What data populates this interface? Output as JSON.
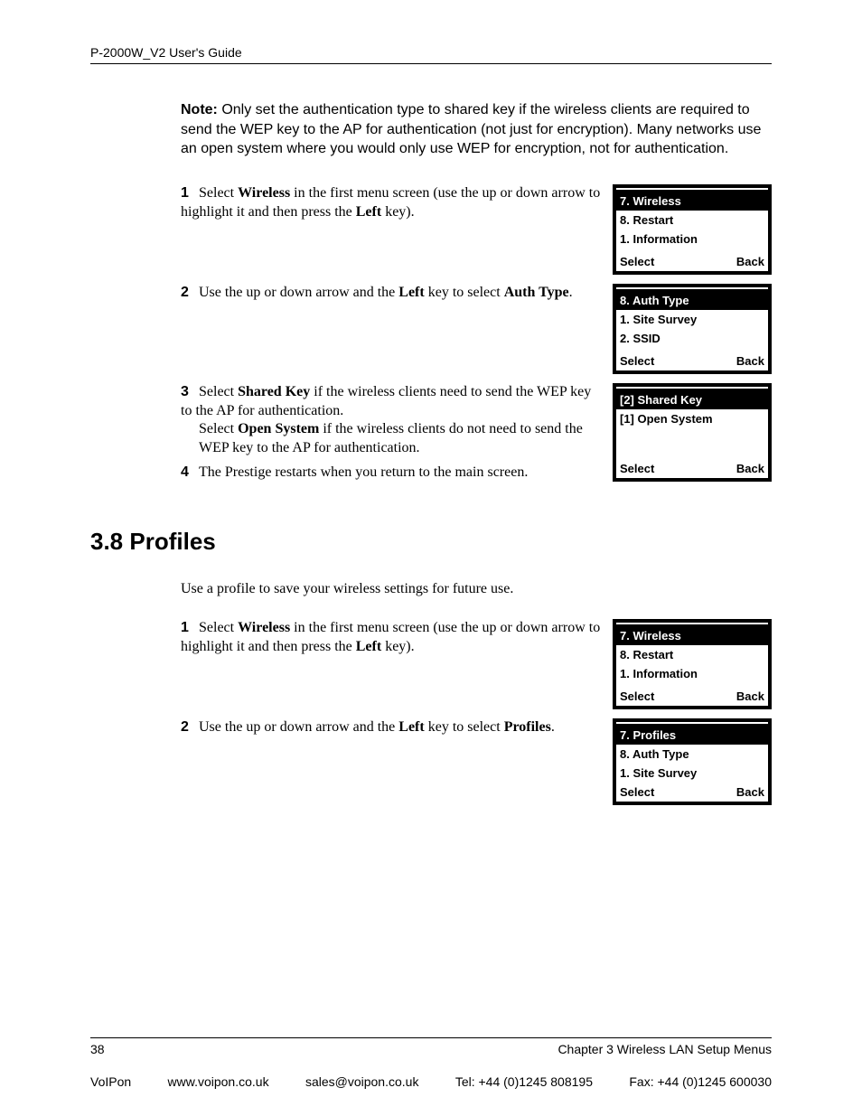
{
  "header_title": "P-2000W_V2 User's Guide",
  "note": {
    "label": "Note:",
    "text": " Only set the authentication type to shared key if the wireless clients are required to send the WEP key to the AP for authentication (not just for encryption). Many networks use an open system where you would only use WEP for encryption, not for authentication."
  },
  "section1": {
    "steps": [
      {
        "num": "1",
        "pre": "Select ",
        "bold1": "Wireless",
        "mid": " in the first menu screen (use the up or down arrow to highlight it and then press the ",
        "bold2": "Left",
        "post": " key)."
      },
      {
        "num": "2",
        "pre": "Use the up or down arrow and the ",
        "bold1": "Left",
        "mid": " key to select ",
        "bold2": "Auth Type",
        "post": "."
      },
      {
        "num": "3",
        "line1_pre": "Select ",
        "line1_b": "Shared Key",
        "line1_post": " if the wireless clients need to send the WEP key to the AP for authentication.",
        "line2_pre": "Select ",
        "line2_b": "Open System",
        "line2_post": " if the wireless clients do not need to send the WEP key to the AP for authentication."
      },
      {
        "num": "4",
        "text": "The Prestige restarts when you return to the main screen."
      }
    ],
    "screens": [
      {
        "selected": "7. Wireless",
        "rows": [
          "8. Restart",
          "1. Information"
        ],
        "left": "Select",
        "right": "Back"
      },
      {
        "selected": "8. Auth Type",
        "rows": [
          "1. Site Survey",
          "2. SSID"
        ],
        "left": "Select",
        "right": "Back"
      },
      {
        "selected": "[2] Shared Key",
        "rows": [
          "[1] Open System"
        ],
        "left": "Select",
        "right": "Back"
      }
    ]
  },
  "heading": "3.8  Profiles",
  "profiles_intro": "Use a profile to save your wireless settings for future use.",
  "section2": {
    "steps": [
      {
        "num": "1",
        "pre": "Select ",
        "bold1": "Wireless",
        "mid": " in the first menu screen (use the up or down arrow to highlight it and then press the ",
        "bold2": "Left",
        "post": " key)."
      },
      {
        "num": "2",
        "pre": "Use the up or down arrow and the ",
        "bold1": "Left",
        "mid": " key to select ",
        "bold2": "Profiles",
        "post": "."
      }
    ],
    "screens": [
      {
        "selected": "7. Wireless",
        "rows": [
          "8. Restart",
          "1. Information"
        ],
        "left": "Select",
        "right": "Back"
      },
      {
        "selected": "7. Profiles",
        "rows": [
          "8. Auth Type",
          "1. Site Survey"
        ],
        "left": "Select",
        "right": "Back"
      }
    ]
  },
  "footer": {
    "page_num": "38",
    "chapter": "Chapter 3 Wireless LAN Setup Menus",
    "contact": {
      "company": "VoIPon",
      "web": "www.voipon.co.uk",
      "email": "sales@voipon.co.uk",
      "tel": "Tel: +44 (0)1245 808195",
      "fax": "Fax: +44 (0)1245 600030"
    }
  }
}
